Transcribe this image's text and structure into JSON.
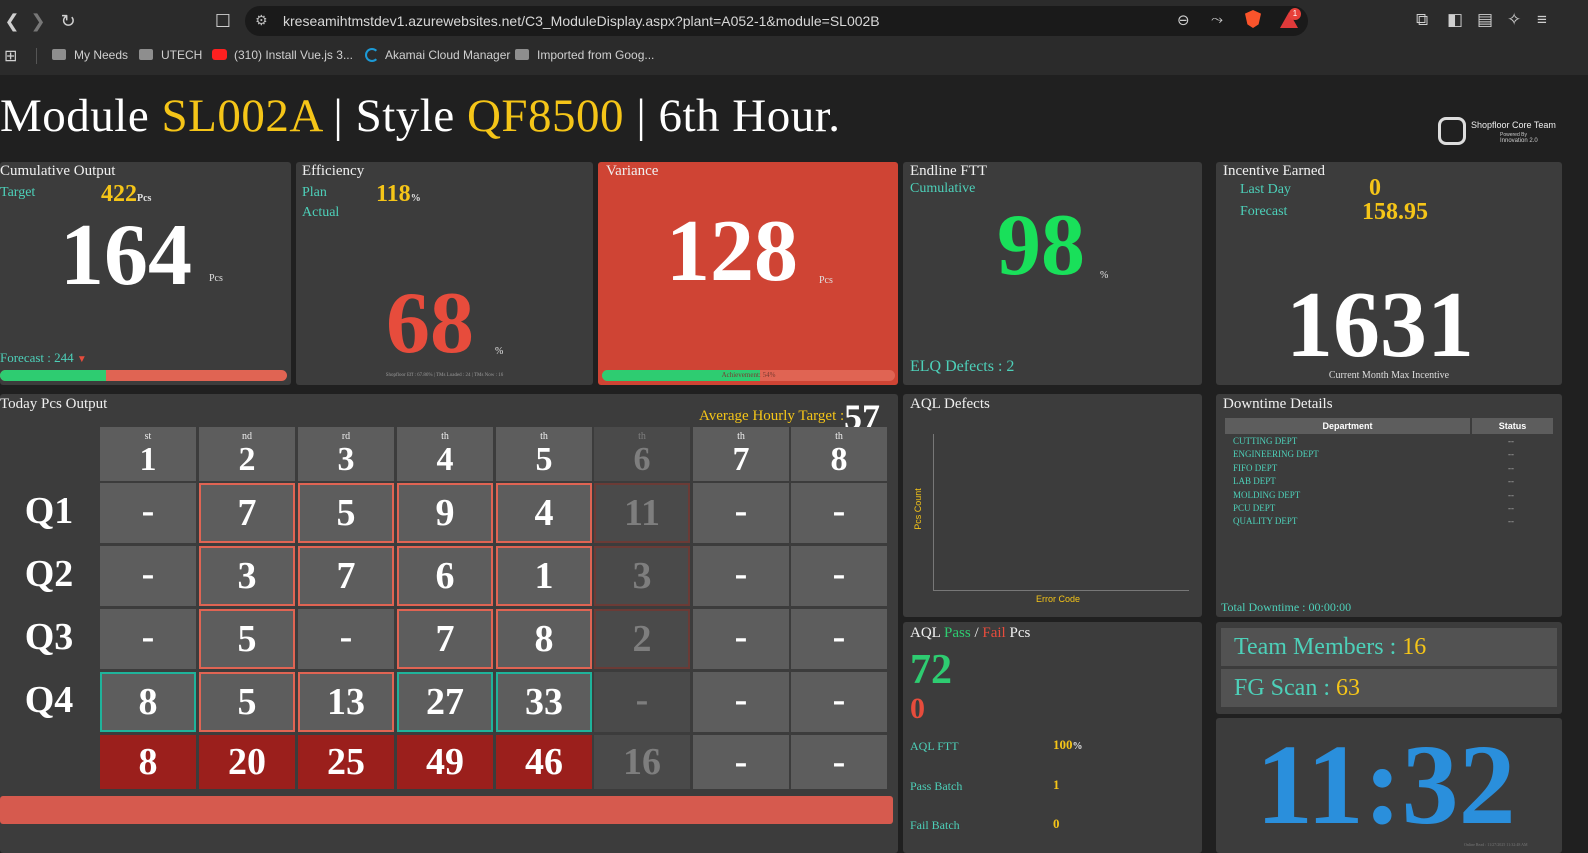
{
  "browser": {
    "url": "kreseamihtmstdev1.azurewebsites.net/C3_ModuleDisplay.aspx?plant=A052-1&module=SL002B",
    "rewards_badge": "1",
    "bookmarks": [
      "My Needs",
      "UTECH",
      "(310) Install Vue.js 3...",
      "Akamai Cloud Manager",
      "Imported from Goog..."
    ]
  },
  "header": {
    "prefix_module": "Module",
    "module": "SL002A",
    "sep1": "|",
    "prefix_style": "Style",
    "style": "QF8500",
    "sep2": "|",
    "hour": "6th Hour.",
    "logo_title": "Shopfloor Core Team",
    "logo_powered": "Powered By",
    "logo_sub": "Innovation 2.0"
  },
  "cumulative": {
    "title": "Cumulative Output",
    "target_label": "Target",
    "target": "422",
    "target_unit": "Pcs",
    "value": "164",
    "unit": "Pcs",
    "forecast": "Forecast : 244",
    "forecast_icon": "down-arrow-red",
    "progress_fraction": 0.37
  },
  "efficiency": {
    "title": "Efficiency",
    "plan_label": "Plan",
    "plan": "118",
    "plan_unit": "%",
    "actual_label": "Actual",
    "value": "68",
    "unit": "%",
    "footer": "Shopfloor Eff : 67.86% | TMs Loaded : 24 | TMs Now : 16"
  },
  "variance": {
    "title": "Variance",
    "value": "128",
    "unit": "Pcs",
    "bar_text": "Achievement: 54%",
    "progress_fraction": 0.54
  },
  "endline": {
    "title": "Endline FTT",
    "subtitle": "Cumulative",
    "value": "98",
    "unit": "%",
    "defects": "ELQ Defects : 2"
  },
  "incentive": {
    "title": "Incentive Earned",
    "last_day_label": "Last Day",
    "last_day": "0",
    "forecast_label": "Forecast",
    "forecast": "158.95",
    "value": "1631",
    "caption": "Current Month Max Incentive"
  },
  "today": {
    "title": "Today Pcs Output",
    "avg_label": "Average Hourly Target :",
    "avg_value": "57",
    "hours": [
      {
        "num": "1",
        "sup": "st"
      },
      {
        "num": "2",
        "sup": "nd"
      },
      {
        "num": "3",
        "sup": "rd"
      },
      {
        "num": "4",
        "sup": "th"
      },
      {
        "num": "5",
        "sup": "th"
      },
      {
        "num": "6",
        "sup": "th"
      },
      {
        "num": "7",
        "sup": "th"
      },
      {
        "num": "8",
        "sup": "th"
      }
    ],
    "quarters": [
      "Q1",
      "Q2",
      "Q3",
      "Q4"
    ],
    "grid": [
      [
        "-",
        "7",
        "5",
        "9",
        "4",
        "11",
        "-",
        "-"
      ],
      [
        "-",
        "3",
        "7",
        "6",
        "1",
        "3",
        "-",
        "-"
      ],
      [
        "-",
        "5",
        "-",
        "7",
        "8",
        "2",
        "-",
        "-"
      ],
      [
        "8",
        "5",
        "13",
        "27",
        "33",
        "-",
        "-",
        "-"
      ]
    ],
    "totals": [
      "8",
      "20",
      "25",
      "49",
      "46",
      "16",
      "-",
      "-"
    ]
  },
  "aql_defects": {
    "title": "AQL Defects",
    "ylabel": "Pcs Count",
    "xlabel": "Error Code"
  },
  "aql_pass_fail": {
    "title_prefix": "AQL",
    "pass_word": "Pass",
    "slash": "/",
    "fail_word": "Fail",
    "pcs_word": "Pcs",
    "pass": "72",
    "fail": "0",
    "ftt_label": "AQL FTT",
    "ftt": "100",
    "ftt_unit": "%",
    "pass_batch_label": "Pass Batch",
    "pass_batch": "1",
    "fail_batch_label": "Fail Batch",
    "fail_batch": "0"
  },
  "downtime": {
    "title": "Downtime Details",
    "col_department": "Department",
    "col_status": "Status",
    "rows": [
      {
        "dept": "CUTTING DEPT",
        "status": "--"
      },
      {
        "dept": "ENGINEERING DEPT",
        "status": "--"
      },
      {
        "dept": "FIFO DEPT",
        "status": "--"
      },
      {
        "dept": "LAB DEPT",
        "status": "--"
      },
      {
        "dept": "MOLDING DEPT",
        "status": "--"
      },
      {
        "dept": "PCU DEPT",
        "status": "--"
      },
      {
        "dept": "QUALITY DEPT",
        "status": "--"
      }
    ],
    "total": "Total Downtime : 00:00:00"
  },
  "team": {
    "members_label": "Team Members :",
    "members": "16",
    "fg_label": "FG Scan :",
    "fg": "63"
  },
  "clock": {
    "time": "11:32",
    "footer": "Online Read : 11/27/2025 11:32:48 AM"
  },
  "colors": {
    "accent_yellow": "#f5c518",
    "teal": "#4dd0b9",
    "green": "#19e05a",
    "red": "#e74c3c",
    "variance_bg": "#cf4434",
    "clock_blue": "#2a8fdc"
  }
}
